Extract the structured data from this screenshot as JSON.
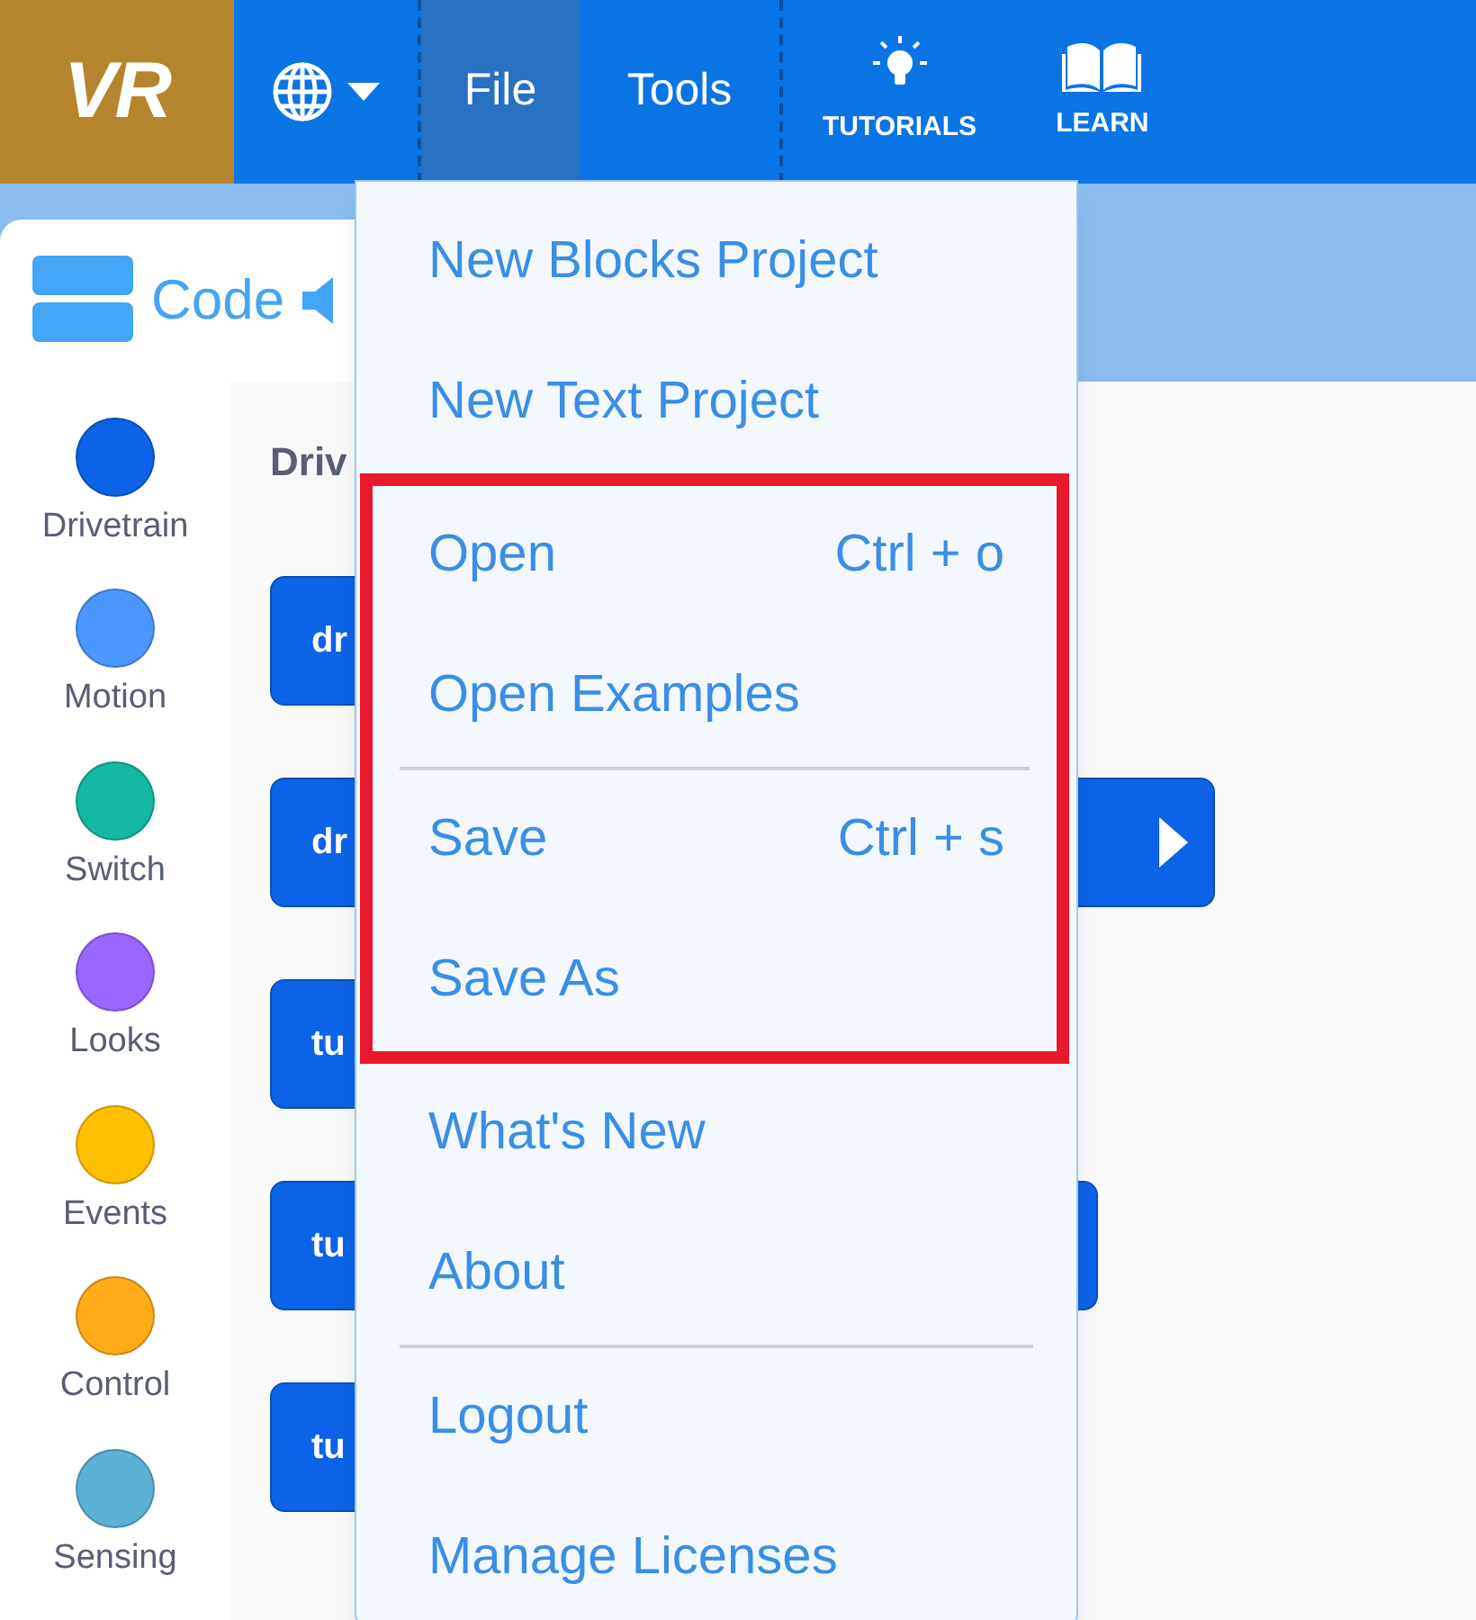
{
  "logo": {
    "text": "VR"
  },
  "nav": [
    {
      "kind": "language",
      "selected": false
    },
    {
      "kind": "text",
      "label": "File",
      "selected": true
    },
    {
      "kind": "text",
      "label": "Tools",
      "selected": false
    },
    {
      "kind": "bulb_link",
      "label": "TUTORIALS",
      "selected": false
    },
    {
      "kind": "book_link",
      "label": "LEARN",
      "selected": false
    }
  ],
  "tab": {
    "label": "Code"
  },
  "categories": [
    {
      "label": "Drivetrain",
      "color": "#0c63e7"
    },
    {
      "label": "Motion",
      "color": "#4c97ff"
    },
    {
      "label": "Switch",
      "color": "#13b9a0"
    },
    {
      "label": "Looks",
      "color": "#9966ff"
    },
    {
      "label": "Events",
      "color": "#ffbf00"
    },
    {
      "label": "Control",
      "color": "#ffab19"
    },
    {
      "label": "Sensing",
      "color": "#5cb1d6"
    }
  ],
  "workspace": {
    "heading": "Driv",
    "blocks": [
      {
        "text": "dr",
        "kind": "short"
      },
      {
        "text": "dr",
        "kind": "runnable"
      },
      {
        "text": "tu",
        "kind": "short"
      },
      {
        "text": "tu",
        "kind": "long"
      },
      {
        "text": "tu",
        "kind": "short"
      }
    ]
  },
  "file_menu": [
    {
      "label": "New Blocks Project",
      "highlighted": false
    },
    {
      "label": "New Text Project",
      "highlighted": false
    },
    {
      "label": "Open",
      "shortcut": "Ctrl + o",
      "highlighted": true
    },
    {
      "label": "Open Examples",
      "highlighted": true,
      "divider_after": true
    },
    {
      "label": "Save",
      "shortcut": "Ctrl + s",
      "highlighted": true
    },
    {
      "label": "Save As",
      "highlighted": true
    },
    {
      "label": "What's New",
      "highlighted": false
    },
    {
      "label": "About",
      "highlighted": false,
      "divider_after": true
    },
    {
      "label": "Logout",
      "highlighted": false
    },
    {
      "label": "Manage Licenses",
      "highlighted": false
    }
  ]
}
